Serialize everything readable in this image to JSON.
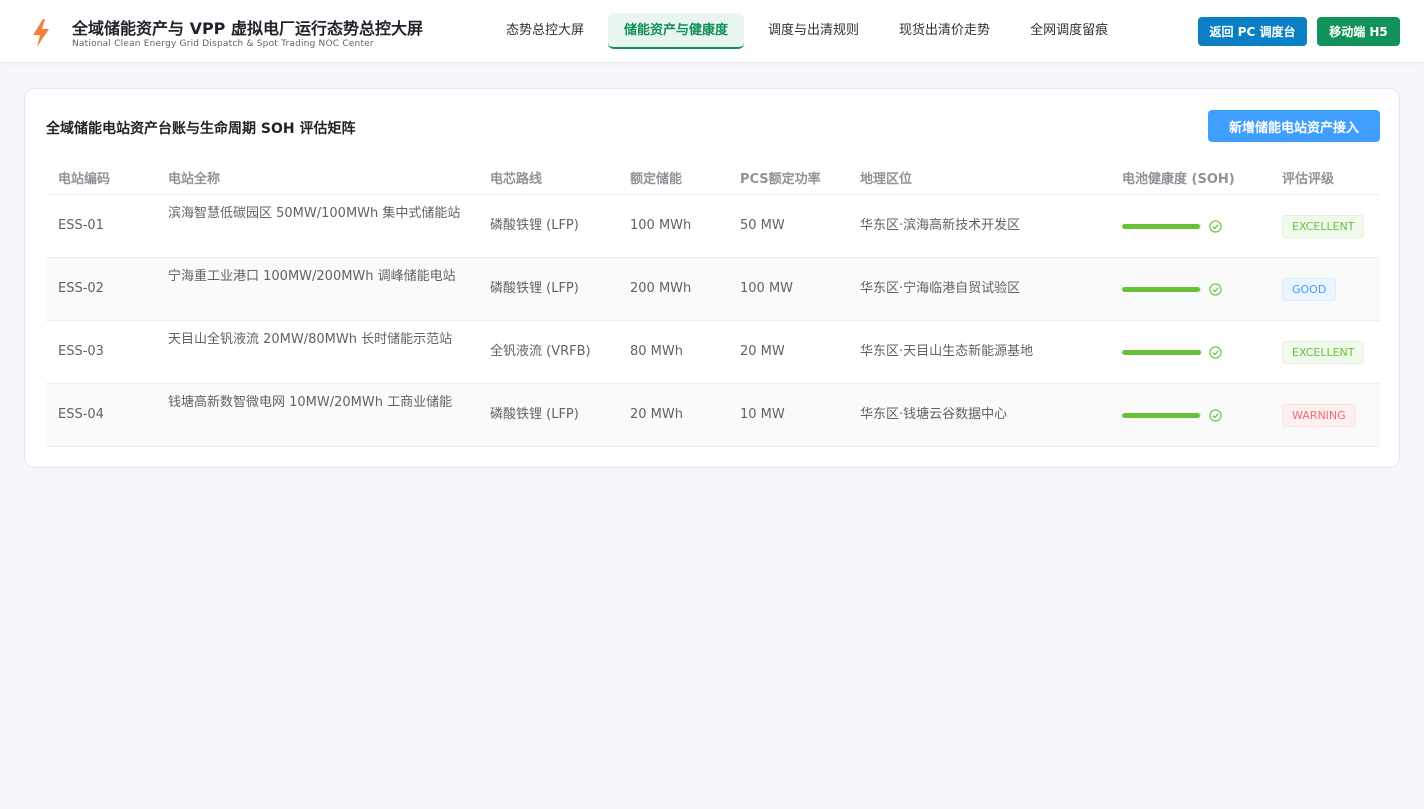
{
  "header": {
    "title": "全域储能资产与 VPP 虚拟电厂运行态势总控大屏",
    "subtitle": "National Clean Energy Grid Dispatch & Spot Trading NOC Center",
    "logo_icon": "lightning-bolt-icon",
    "tabs": [
      {
        "label": "态势总控大屏",
        "active": false
      },
      {
        "label": "储能资产与健康度",
        "active": true
      },
      {
        "label": "调度与出清规则",
        "active": false
      },
      {
        "label": "现货出清价走势",
        "active": false
      },
      {
        "label": "全网调度留痕",
        "active": false
      }
    ],
    "pc_button": "返回 PC 调度台",
    "h5_button": "移动端 H5"
  },
  "card": {
    "title": "全域储能电站资产台账与生命周期 SOH 评估矩阵",
    "add_button": "新增储能电站资产接入"
  },
  "table": {
    "headers": [
      "电站编码",
      "电站全称",
      "电芯路线",
      "额定储能",
      "PCS额定功率",
      "地理区位",
      "电池健康度 (SOH)",
      "评估评级"
    ],
    "rows": [
      {
        "code": "ESS-01",
        "name": "滨海智慧低碳园区 50MW/100MWh 集中式储能站",
        "cell": "磷酸铁锂 (LFP)",
        "capacity": "100 MWh",
        "power": "50 MW",
        "location": "华东区·滨海高新技术开发区",
        "soh": 0.98,
        "grade": "EXCELLENT",
        "grade_type": "excellent"
      },
      {
        "code": "ESS-02",
        "name": "宁海重工业港口 100MW/200MWh 调峰储能电站",
        "cell": "磷酸铁锂 (LFP)",
        "capacity": "200 MWh",
        "power": "100 MW",
        "location": "华东区·宁海临港自贸试验区",
        "soh": 0.97,
        "grade": "GOOD",
        "grade_type": "good"
      },
      {
        "code": "ESS-03",
        "name": "天目山全钒液流 20MW/80MWh 长时储能示范站",
        "cell": "全钒液流 (VRFB)",
        "capacity": "80 MWh",
        "power": "20 MW",
        "location": "华东区·天目山生态新能源基地",
        "soh": 0.99,
        "grade": "EXCELLENT",
        "grade_type": "excellent"
      },
      {
        "code": "ESS-04",
        "name": "钱塘高新数智微电网 10MW/20MWh 工商业储能",
        "cell": "磷酸铁锂 (LFP)",
        "capacity": "20 MWh",
        "power": "10 MW",
        "location": "华东区·钱塘云谷数据中心",
        "soh": 0.97,
        "grade": "WARNING",
        "grade_type": "warning"
      }
    ],
    "soh_icon": "check-circle-icon"
  }
}
